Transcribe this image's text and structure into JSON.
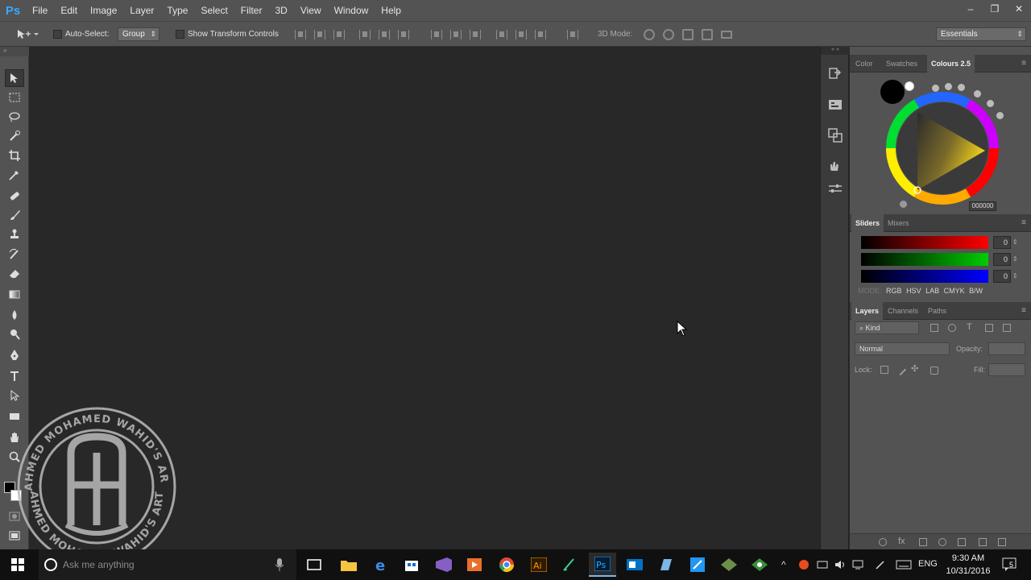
{
  "app": {
    "logo": "Ps",
    "menu": [
      "File",
      "Edit",
      "Image",
      "Layer",
      "Type",
      "Select",
      "Filter",
      "3D",
      "View",
      "Window",
      "Help"
    ],
    "window_controls": [
      "–",
      "❐",
      "✕"
    ]
  },
  "options_bar": {
    "auto_select_label": "Auto-Select:",
    "auto_select_target": "Group",
    "show_transform_label": "Show Transform Controls",
    "three_d_mode_label": "3D Mode:",
    "workspace": "Essentials"
  },
  "color_panel": {
    "tabs": [
      "Color",
      "Swatches",
      "Colours 2.5"
    ],
    "active_tab": "Colours 2.5",
    "hex_value": "000000",
    "foreground_color": "#000000"
  },
  "sliders_panel": {
    "tabs": [
      "Sliders",
      "Mixers"
    ],
    "channels": [
      {
        "name": "R",
        "value": "0",
        "color": "#ff0000"
      },
      {
        "name": "G",
        "value": "0",
        "color": "#00cc00"
      },
      {
        "name": "B",
        "value": "0",
        "color": "#0000ff"
      }
    ],
    "mode_label": "MODE:",
    "modes": [
      "RGB",
      "HSV",
      "LAB",
      "CMYK",
      "B/W"
    ]
  },
  "layers_panel": {
    "tabs": [
      "Layers",
      "Channels",
      "Paths"
    ],
    "filter_kind": "Kind",
    "blend_mode": "Normal",
    "opacity_label": "Opacity:",
    "lock_label": "Lock:",
    "fill_label": "Fill:"
  },
  "watermark": {
    "text": "AHMED MOHAMED WAHID'S ART"
  },
  "taskbar": {
    "search_placeholder": "Ask me anything",
    "time": "9:30 AM",
    "date": "10/31/2016",
    "language": "ENG",
    "notification_count": "5"
  }
}
